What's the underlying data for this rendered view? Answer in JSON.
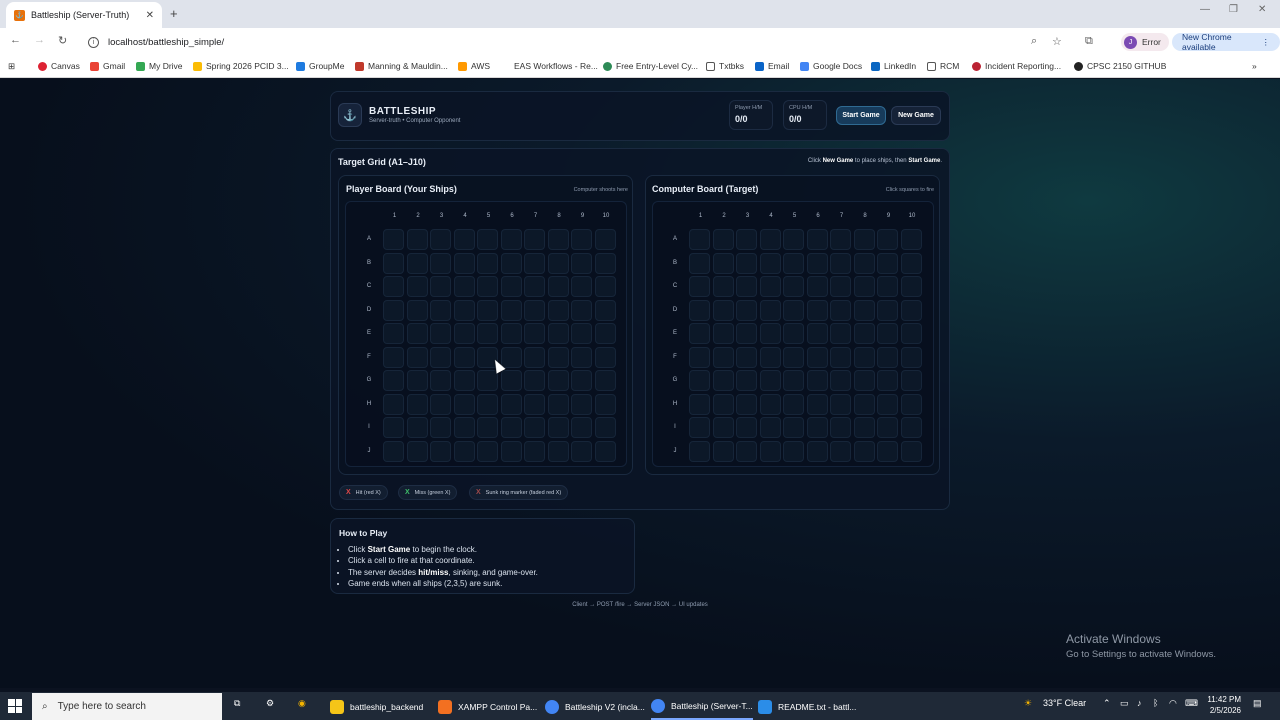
{
  "browser": {
    "tab_title": "Battleship (Server-Truth)",
    "url": "localhost/battleship_simple/",
    "profile_status": "Error",
    "profile_initial": "J",
    "update_label": "New Chrome available",
    "bookmarks": [
      "Canvas",
      "Gmail",
      "My Drive",
      "Spring 2026 PCID 3...",
      "GroupMe",
      "Manning & Mauldin...",
      "AWS",
      "EAS Workflows - Re...",
      "Free Entry-Level Cy...",
      "Txtbks",
      "Email",
      "Google Docs",
      "LinkedIn",
      "RCM",
      "Incident Reporting...",
      "CPSC 2150 GITHUB"
    ]
  },
  "app": {
    "title": "BATTLESHIP",
    "subtitle": "Server-truth • Computer Opponent",
    "player_label": "Player H/M",
    "player_value": "0/0",
    "cpu_label": "CPU H/M",
    "cpu_value": "0/0",
    "start_label": "Start Game",
    "new_label": "New Game"
  },
  "target": {
    "title": "Target Grid (A1–J10)",
    "hint_prefix": "Click ",
    "hint_b1": "New Game",
    "hint_mid": " to place ships, then ",
    "hint_b2": "Start Game",
    "hint_suffix": "."
  },
  "boards": {
    "player_title": "Player Board (Your Ships)",
    "player_hint": "Computer shoots here",
    "computer_title": "Computer Board (Target)",
    "computer_hint": "Click squares to fire",
    "columns": [
      "1",
      "2",
      "3",
      "4",
      "5",
      "6",
      "7",
      "8",
      "9",
      "10"
    ],
    "rows": [
      "A",
      "B",
      "C",
      "D",
      "E",
      "F",
      "G",
      "H",
      "I",
      "J"
    ]
  },
  "legend": {
    "hit": "Hit (red X)",
    "miss": "Miss (green X)",
    "sunk": "Sunk ring marker (faded red X)",
    "mark": "X"
  },
  "howto": {
    "title": "How to Play",
    "l1a": "Click ",
    "l1b": "Start Game",
    "l1c": " to begin the clock.",
    "l2": "Click a cell to fire at that coordinate.",
    "l3a": "The server decides ",
    "l3b": "hit/miss",
    "l3c": ", sinking, and game-over.",
    "l4": "Game ends when all ships (2,3,5) are sunk."
  },
  "footer": "Client → POST /fire → Server JSON → UI updates",
  "watermark": {
    "line1": "Activate Windows",
    "line2": "Go to Settings to activate Windows."
  },
  "taskbar": {
    "search_placeholder": "Type here to search",
    "apps": [
      "battleship_backend",
      "XAMPP Control Pa...",
      "Battleship V2 (incla...",
      "Battleship (Server-T...",
      "README.txt - battl..."
    ],
    "weather": "33°F  Clear",
    "time": "11:42 PM",
    "date": "2/5/2026"
  },
  "colors": {
    "hit": "#e04848",
    "miss": "#3fbf6a",
    "sunk": "#a04a4a",
    "accent": "#2f6a92"
  }
}
